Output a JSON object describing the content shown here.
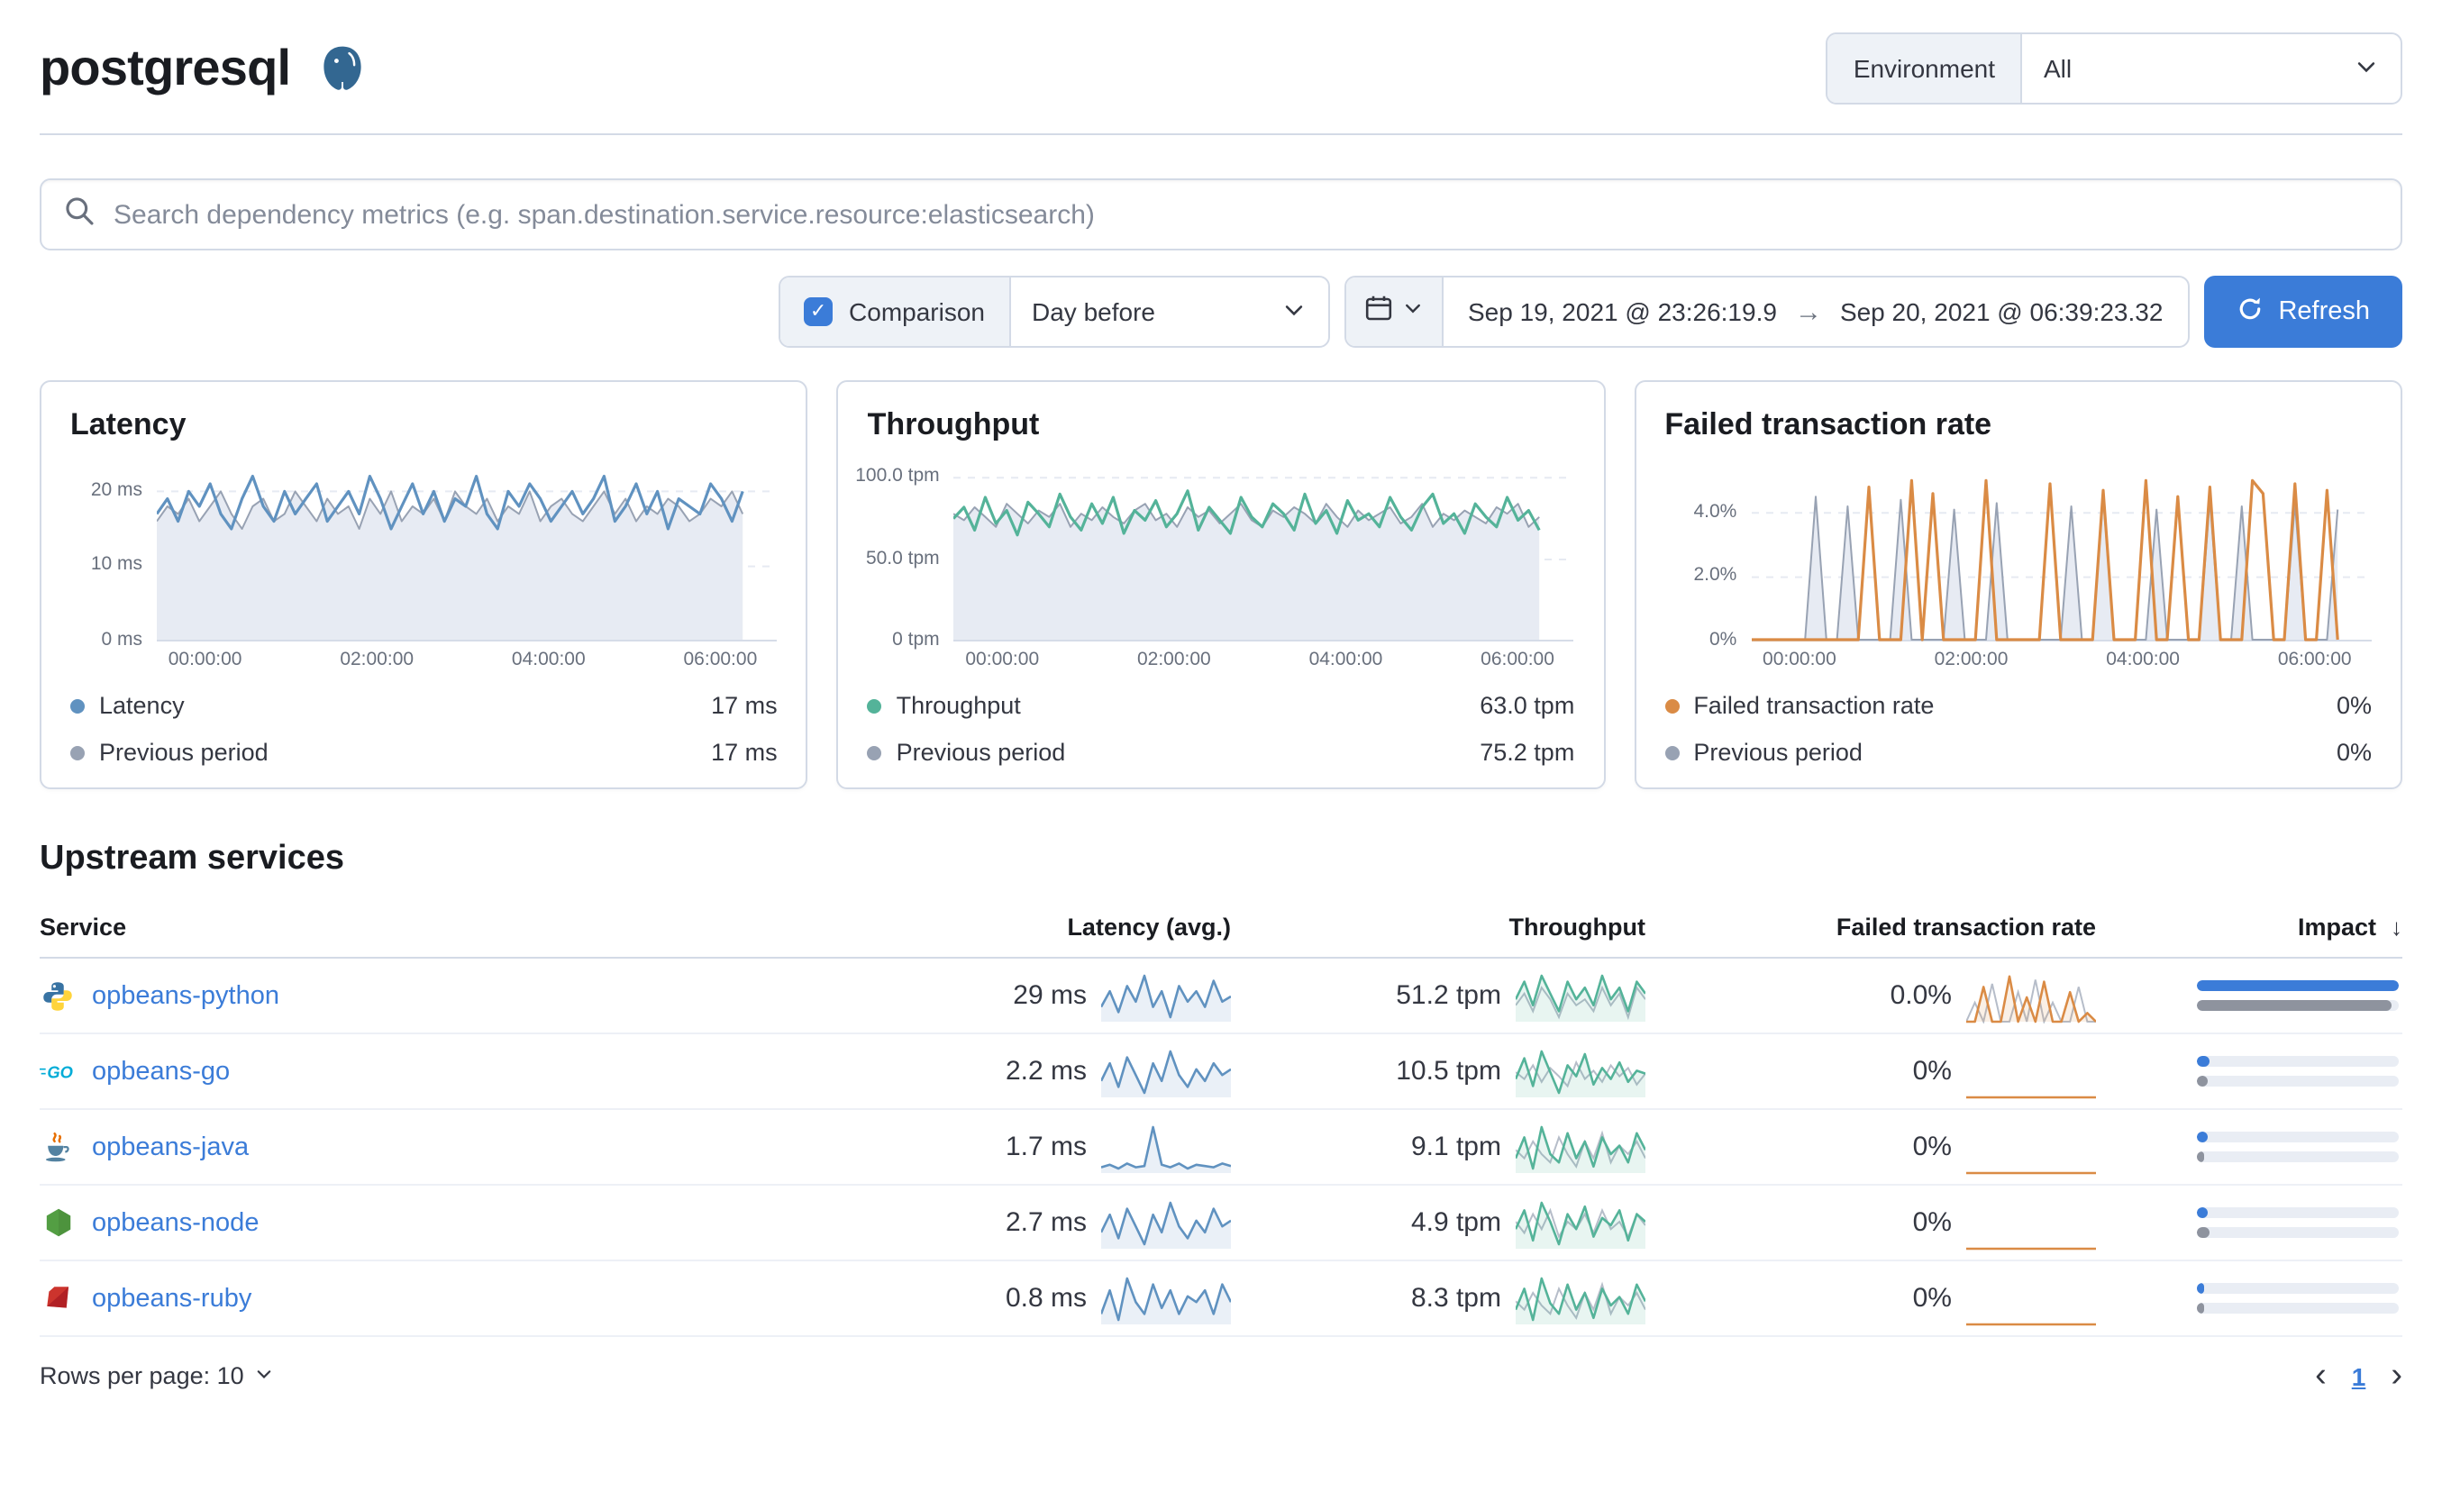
{
  "colors": {
    "primary": "#3b7cd8",
    "link": "#3b7cd8",
    "latency": "#6092C0",
    "throughput": "#54B399",
    "failed": "#DA8B45",
    "previous": "#98A2B3",
    "previous_fill": "#E7EBF3"
  },
  "icons": {
    "arrow_right": "→",
    "sort_desc": "↓",
    "chevron_left": "‹",
    "chevron_right": "›",
    "check": "✓"
  },
  "header": {
    "title": "postgresql",
    "environment_label": "Environment",
    "environment_value": "All"
  },
  "search": {
    "placeholder": "Search dependency metrics (e.g. span.destination.service.resource:elasticsearch)"
  },
  "controls": {
    "comparison_label": "Comparison",
    "comparison_checked": true,
    "period_select": "Day before",
    "date_start": "Sep 19, 2021 @ 23:26:19.9",
    "date_end": "Sep 20, 2021 @ 06:39:23.32",
    "refresh_label": "Refresh"
  },
  "chart_data": [
    {
      "type": "line",
      "title": "Latency",
      "ylim": [
        0,
        24
      ],
      "yticks": [
        {
          "v": 0,
          "label": "0 ms"
        },
        {
          "v": 10,
          "label": "10 ms"
        },
        {
          "v": 20,
          "label": "20 ms"
        }
      ],
      "xticks": [
        "00:00:00",
        "02:00:00",
        "04:00:00",
        "06:00:00"
      ],
      "series": [
        {
          "name": "Previous period",
          "color": "#98A2B3",
          "fill": "#E7EBF3",
          "width": 1,
          "values": [
            16,
            18,
            17,
            19,
            16,
            18,
            20,
            17,
            15,
            18,
            19,
            16,
            17,
            20,
            18,
            16,
            19,
            17,
            18,
            15,
            19,
            17,
            20,
            16,
            18,
            17,
            19,
            16,
            20,
            18,
            17,
            19,
            16,
            18,
            17,
            20,
            16,
            18,
            19,
            17,
            16,
            18,
            20,
            17,
            19,
            16,
            18,
            17,
            19,
            18,
            16,
            17,
            19,
            18,
            20,
            17
          ]
        },
        {
          "name": "Latency",
          "color": "#6092C0",
          "fill": "none",
          "width": 1.6,
          "values": [
            17,
            19,
            16,
            20,
            18,
            21,
            17,
            15,
            19,
            22,
            18,
            16,
            20,
            17,
            19,
            21,
            16,
            18,
            20,
            17,
            22,
            19,
            15,
            18,
            21,
            17,
            20,
            16,
            19,
            18,
            22,
            17,
            15,
            20,
            18,
            21,
            19,
            16,
            18,
            20,
            17,
            19,
            22,
            16,
            18,
            21,
            17,
            20,
            15,
            19,
            18,
            17,
            21,
            19,
            16,
            20
          ]
        }
      ],
      "legend": [
        {
          "label": "Latency",
          "value": "17 ms",
          "color": "#6092C0"
        },
        {
          "label": "Previous period",
          "value": "17 ms",
          "color": "#98A2B3"
        }
      ]
    },
    {
      "type": "line",
      "title": "Throughput",
      "ylim": [
        0,
        110
      ],
      "yticks": [
        {
          "v": 0,
          "label": "0 tpm"
        },
        {
          "v": 50,
          "label": "50.0 tpm"
        },
        {
          "v": 100,
          "label": "100.0 tpm"
        }
      ],
      "xticks": [
        "00:00:00",
        "02:00:00",
        "04:00:00",
        "06:00:00"
      ],
      "series": [
        {
          "name": "Previous period",
          "color": "#98A2B3",
          "fill": "#E7EBF3",
          "width": 1,
          "values": [
            78,
            74,
            82,
            76,
            70,
            84,
            78,
            72,
            80,
            76,
            84,
            70,
            78,
            74,
            82,
            76,
            72,
            80,
            84,
            74,
            78,
            70,
            82,
            76,
            80,
            72,
            78,
            84,
            74,
            70,
            80,
            76,
            82,
            78,
            72,
            84,
            76,
            70,
            80,
            74,
            78,
            82,
            72,
            76,
            84,
            70,
            78,
            74,
            80,
            76,
            72,
            82,
            78,
            84,
            70,
            76
          ]
        },
        {
          "name": "Throughput",
          "color": "#54B399",
          "fill": "none",
          "width": 1.6,
          "values": [
            75,
            82,
            68,
            88,
            72,
            80,
            65,
            85,
            78,
            70,
            90,
            76,
            68,
            84,
            72,
            88,
            66,
            80,
            74,
            86,
            70,
            78,
            92,
            68,
            82,
            74,
            66,
            88,
            76,
            70,
            84,
            78,
            68,
            90,
            72,
            80,
            66,
            86,
            74,
            78,
            70,
            88,
            76,
            68,
            82,
            90,
            72,
            78,
            66,
            84,
            76,
            70,
            88,
            74,
            80,
            68
          ]
        }
      ],
      "legend": [
        {
          "label": "Throughput",
          "value": "63.0 tpm",
          "color": "#54B399"
        },
        {
          "label": "Previous period",
          "value": "75.2 tpm",
          "color": "#98A2B3"
        }
      ]
    },
    {
      "type": "line",
      "title": "Failed transaction rate",
      "ylim": [
        0,
        5.6
      ],
      "yticks": [
        {
          "v": 0,
          "label": "0%"
        },
        {
          "v": 2,
          "label": "2.0%"
        },
        {
          "v": 4,
          "label": "4.0%"
        }
      ],
      "xticks": [
        "00:00:00",
        "02:00:00",
        "04:00:00",
        "06:00:00"
      ],
      "series": [
        {
          "name": "Previous period",
          "color": "#98A2B3",
          "fill": "#E7EBF3",
          "width": 1,
          "values": [
            0,
            0,
            0,
            0,
            0,
            0,
            4.5,
            0,
            0,
            4.2,
            0,
            0,
            0,
            0,
            4.4,
            0,
            0,
            0,
            0,
            4.1,
            0,
            0,
            0,
            4.3,
            0,
            0,
            0,
            0,
            0,
            0,
            4.2,
            0,
            0,
            4.5,
            0,
            0,
            0,
            0,
            4.1,
            0,
            0,
            0,
            0,
            4.4,
            0,
            0,
            4.2,
            0,
            0,
            0,
            0,
            4.3,
            0,
            0,
            0,
            4.1
          ]
        },
        {
          "name": "Failed transaction rate",
          "color": "#DA8B45",
          "fill": "none",
          "width": 1.6,
          "values": [
            0,
            0,
            0,
            0,
            0,
            0,
            0,
            0,
            0,
            0,
            0,
            4.8,
            0,
            0,
            0,
            5,
            0,
            4.6,
            0,
            0,
            0,
            0,
            5,
            0,
            0,
            0,
            0,
            0,
            4.9,
            0,
            0,
            0,
            0,
            4.7,
            0,
            0,
            0,
            5,
            0,
            0,
            4.5,
            0,
            0,
            4.8,
            0,
            0,
            0,
            5,
            4.6,
            0,
            0,
            4.9,
            0,
            0,
            4.7,
            0
          ]
        }
      ],
      "legend": [
        {
          "label": "Failed transaction rate",
          "value": "0%",
          "color": "#DA8B45"
        },
        {
          "label": "Previous period",
          "value": "0%",
          "color": "#98A2B3"
        }
      ]
    }
  ],
  "table": {
    "title": "Upstream services",
    "columns": [
      "Service",
      "Latency (avg.)",
      "Throughput",
      "Failed transaction rate",
      "Impact"
    ],
    "rows": [
      {
        "name": "opbeans-python",
        "latency": "29 ms",
        "throughput": "51.2 tpm",
        "failed": "0.0%",
        "impact": 1,
        "impact_prev": 0.96,
        "latency_spark": [
          27,
          30,
          26,
          31,
          28,
          33,
          27,
          30,
          25,
          31,
          28,
          30,
          27,
          32,
          28,
          29
        ],
        "throughput_spark": [
          50,
          53,
          49,
          54,
          51,
          48,
          53,
          50,
          52,
          49,
          54,
          50,
          52,
          48,
          53,
          51
        ],
        "throughput_prev": [
          49,
          51,
          48,
          52,
          50,
          47,
          51,
          49,
          50,
          48,
          52,
          49,
          51,
          47,
          52,
          50
        ],
        "failed_spark": [
          0,
          0,
          3.5,
          0,
          0,
          4.5,
          0,
          2.5,
          0,
          4,
          0,
          0,
          3,
          0,
          1,
          0
        ],
        "failed_prev": [
          0,
          2,
          0,
          3.8,
          0,
          0,
          3,
          0,
          4.2,
          0,
          2,
          0,
          0,
          3.5,
          0,
          0
        ]
      },
      {
        "name": "opbeans-go",
        "latency": "2.2 ms",
        "throughput": "10.5 tpm",
        "failed": "0%",
        "impact": 0.06,
        "impact_prev": 0.05,
        "latency_spark": [
          2.1,
          2.4,
          2.0,
          2.5,
          2.2,
          1.9,
          2.4,
          2.1,
          2.6,
          2.2,
          2.0,
          2.3,
          2.1,
          2.4,
          2.2,
          2.3
        ],
        "throughput_spark": [
          10,
          11.5,
          9.5,
          12,
          10.5,
          9,
          11,
          10.2,
          11.8,
          9.6,
          10.8,
          10,
          11.2,
          9.8,
          10.6,
          10.4
        ],
        "throughput_prev": [
          10.5,
          10,
          11,
          9.8,
          10.8,
          10.2,
          9.5,
          11.2,
          10,
          10.6,
          9.8,
          11,
          10.2,
          10.8,
          9.6,
          10.4
        ],
        "failed_spark": [
          0,
          0,
          0,
          0,
          0,
          0,
          0,
          0,
          0,
          0,
          0,
          0,
          0,
          0,
          0,
          0
        ],
        "failed_prev": [
          0,
          0,
          0,
          0,
          0,
          0,
          0,
          0,
          0,
          0,
          0,
          0,
          0,
          0,
          0,
          0
        ]
      },
      {
        "name": "opbeans-java",
        "latency": "1.7 ms",
        "throughput": "9.1 tpm",
        "failed": "0%",
        "impact": 0.05,
        "impact_prev": 0.04,
        "latency_spark": [
          1.5,
          1.7,
          1.4,
          1.8,
          1.5,
          1.6,
          4.6,
          1.7,
          1.5,
          1.8,
          1.4,
          1.7,
          1.6,
          1.5,
          1.8,
          1.6
        ],
        "throughput_spark": [
          9,
          10,
          8.5,
          10.5,
          9.2,
          8.8,
          10.2,
          9,
          9.8,
          8.6,
          10,
          9.2,
          9.6,
          8.8,
          10.2,
          9.4
        ],
        "throughput_prev": [
          9.4,
          9,
          9.8,
          9.2,
          8.8,
          10,
          9.2,
          8.6,
          9.8,
          9,
          10.2,
          8.8,
          9.6,
          9.2,
          9.8,
          9
        ],
        "failed_spark": [
          0,
          0,
          0,
          0,
          0,
          0,
          0,
          0,
          0,
          0,
          0,
          0,
          0,
          0,
          0,
          0
        ],
        "failed_prev": [
          0,
          0,
          0,
          0,
          0,
          0,
          0,
          0,
          0,
          0,
          0,
          0,
          0,
          0,
          0,
          0
        ]
      },
      {
        "name": "opbeans-node",
        "latency": "2.7 ms",
        "throughput": "4.9 tpm",
        "failed": "0%",
        "impact": 0.05,
        "impact_prev": 0.06,
        "latency_spark": [
          2.6,
          2.9,
          2.5,
          3.0,
          2.7,
          2.4,
          2.9,
          2.6,
          3.1,
          2.7,
          2.5,
          2.8,
          2.6,
          3.0,
          2.7,
          2.8
        ],
        "throughput_spark": [
          4.8,
          5.3,
          4.5,
          5.5,
          5,
          4.4,
          5.2,
          4.8,
          5.4,
          4.6,
          5.1,
          4.9,
          5.3,
          4.5,
          5.2,
          5
        ],
        "throughput_prev": [
          5,
          4.7,
          5.2,
          4.8,
          5.3,
          4.6,
          5,
          4.8,
          5.2,
          4.7,
          5.3,
          4.8,
          5,
          4.6,
          5.2,
          4.9
        ],
        "failed_spark": [
          0,
          0,
          0,
          0,
          0,
          0,
          0,
          0,
          0,
          0,
          0,
          0,
          0,
          0,
          0,
          0
        ],
        "failed_prev": [
          0,
          0,
          0,
          0,
          0,
          0,
          0,
          0,
          0,
          0,
          0,
          0,
          0,
          0,
          0,
          0
        ]
      },
      {
        "name": "opbeans-ruby",
        "latency": "0.8 ms",
        "throughput": "8.3 tpm",
        "failed": "0%",
        "impact": 0.04,
        "impact_prev": 0.04,
        "latency_spark": [
          0.7,
          0.9,
          0.65,
          1.0,
          0.8,
          0.7,
          0.95,
          0.75,
          0.9,
          0.7,
          0.85,
          0.8,
          0.9,
          0.7,
          0.95,
          0.8
        ],
        "throughput_spark": [
          8,
          9,
          7.5,
          9.5,
          8.3,
          7.8,
          9.2,
          8,
          8.8,
          7.6,
          9,
          8.2,
          8.6,
          7.8,
          9.2,
          8.4
        ],
        "throughput_prev": [
          8.4,
          8,
          8.8,
          8.2,
          7.8,
          9,
          8.2,
          7.6,
          8.8,
          8,
          9.2,
          7.8,
          8.6,
          8.2,
          8.8,
          8
        ],
        "failed_spark": [
          0,
          0,
          0,
          0,
          0,
          0,
          0,
          0,
          0,
          0,
          0,
          0,
          0,
          0,
          0,
          0
        ],
        "failed_prev": [
          0,
          0,
          0,
          0,
          0,
          0,
          0,
          0,
          0,
          0,
          0,
          0,
          0,
          0,
          0,
          0
        ]
      }
    ]
  },
  "pagination": {
    "rows_per_page": "Rows per page: 10",
    "page": "1"
  }
}
